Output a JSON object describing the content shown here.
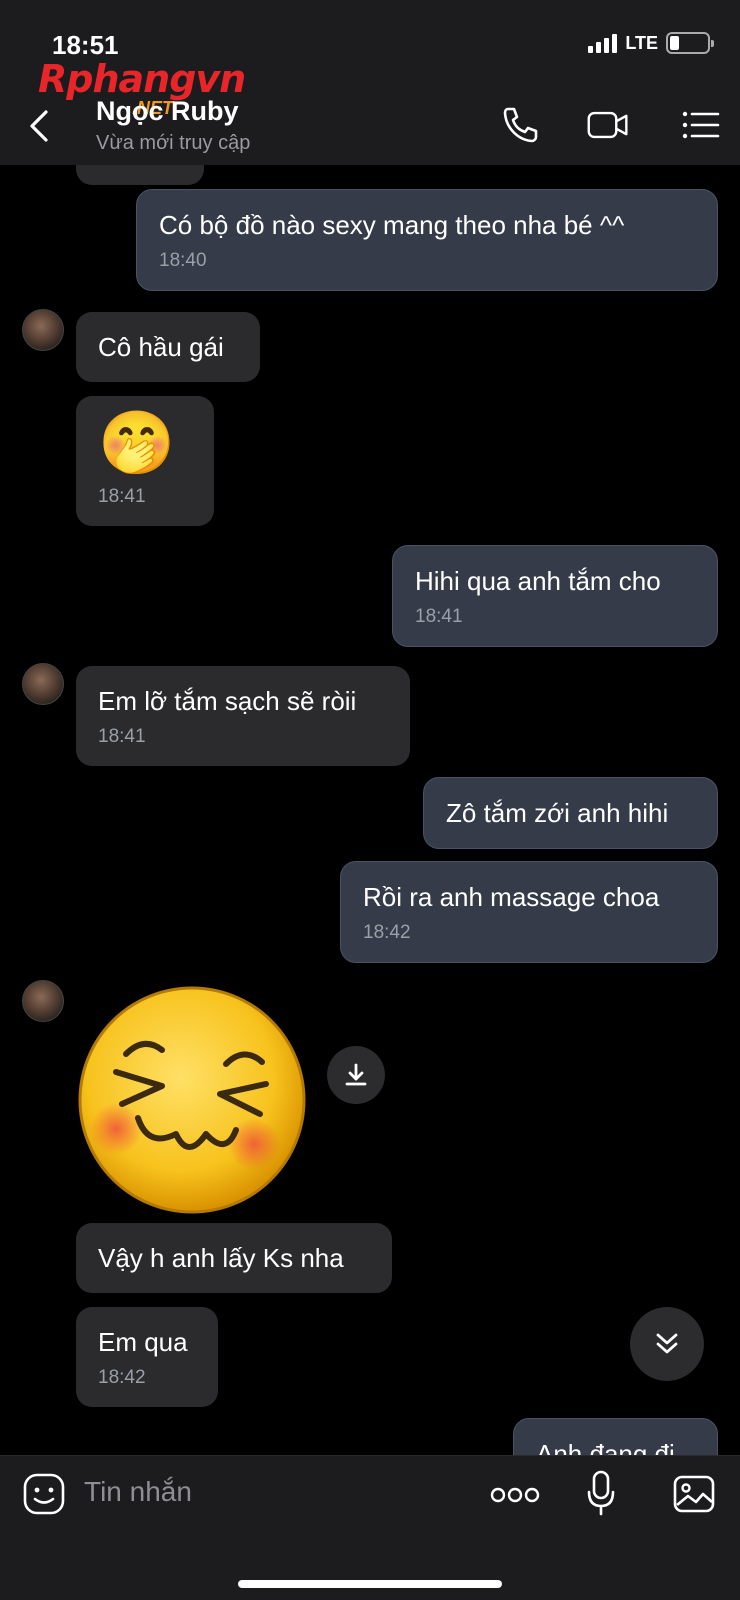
{
  "status_bar": {
    "time": "18:51",
    "network": "LTE"
  },
  "watermark": {
    "brand": "Rphangvn",
    "suffix": ".NET"
  },
  "header": {
    "contact_name": "Ngọc Ruby",
    "contact_status": "Vừa mới truy cập"
  },
  "messages": [
    {
      "dir": "out",
      "text": "Có bộ đồ nào sexy mang theo nha bé ^^",
      "time": "18:40"
    },
    {
      "dir": "in",
      "text": "Cô hầu gái"
    },
    {
      "dir": "in",
      "emoji": "🤭",
      "time": "18:41"
    },
    {
      "dir": "out",
      "text": "Hihi qua anh tắm cho",
      "time": "18:41"
    },
    {
      "dir": "in",
      "text": "Em lỡ tắm sạch sẽ ròii",
      "time": "18:41"
    },
    {
      "dir": "out",
      "text": "Zô tắm zới anh hihi"
    },
    {
      "dir": "out",
      "text": "Rồi ra anh massage choa",
      "time": "18:42"
    },
    {
      "dir": "in",
      "sticker": "laughing-blush-face"
    },
    {
      "dir": "in",
      "text": "Vậy h anh lấy Ks nha"
    },
    {
      "dir": "in",
      "text": "Em qua",
      "time": "18:42"
    },
    {
      "dir": "out",
      "text": "Anh đang đi"
    }
  ],
  "composer": {
    "placeholder": "Tin nhắn"
  },
  "colors": {
    "incoming_bubble": "#2b2b2d",
    "outgoing_bubble": "#353b48",
    "background": "#000000",
    "bar": "#1c1c1e"
  }
}
